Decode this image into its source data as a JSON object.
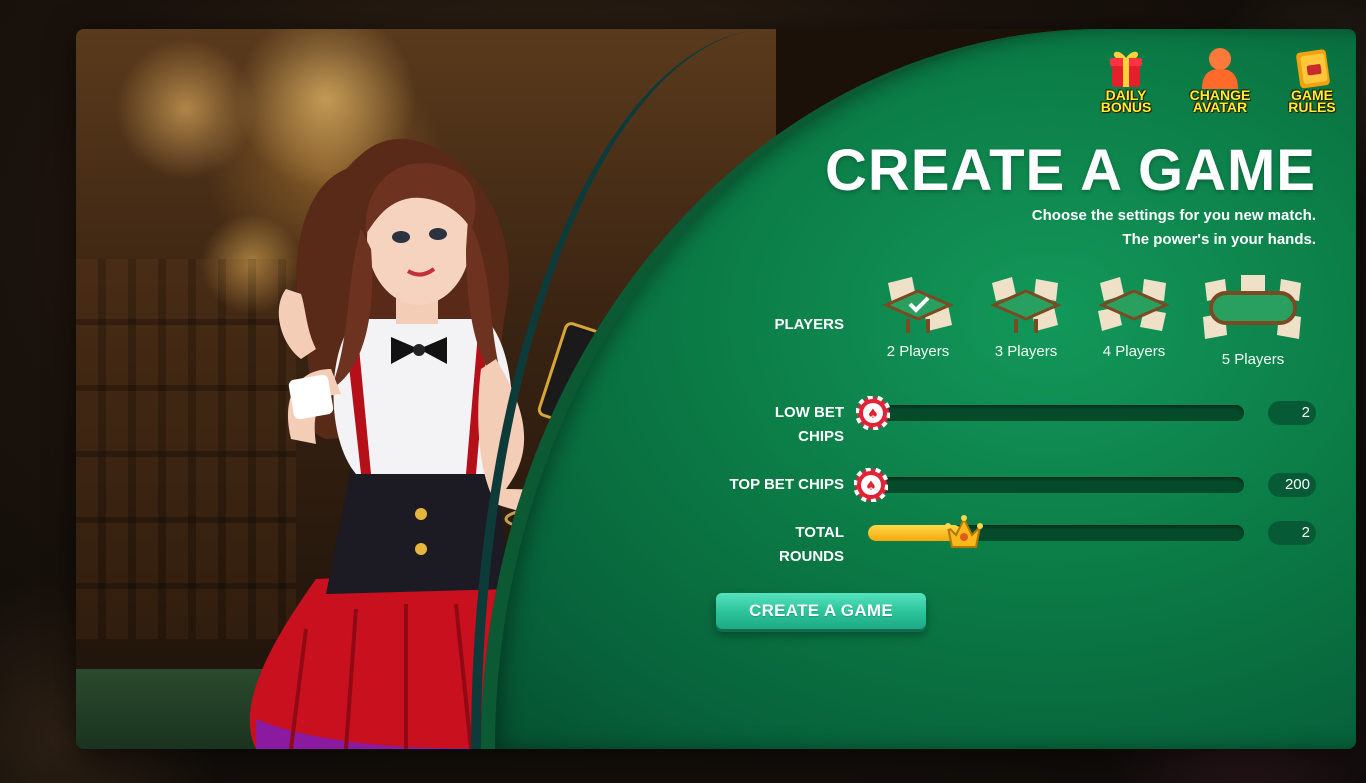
{
  "header_buttons": {
    "daily_bonus": "DAILY\nBONUS",
    "change_avatar": "CHANGE\nAVATAR",
    "game_rules": "GAME\nRULES"
  },
  "header_button_labels": {
    "daily_bonus_line1": "DAILY",
    "daily_bonus_line2": "BONUS",
    "change_avatar_line1": "CHANGE",
    "change_avatar_line2": "AVATAR",
    "game_rules_line1": "GAME",
    "game_rules_line2": "RULES"
  },
  "title": "CREATE A GAME",
  "subtitle_line1": "Choose the settings for you new match.",
  "subtitle_line2": "The power's in your hands.",
  "players": {
    "label": "PLAYERS",
    "options": [
      {
        "label": "2 Players",
        "selected": true
      },
      {
        "label": "3 Players",
        "selected": false
      },
      {
        "label": "4 Players",
        "selected": false
      },
      {
        "label": "5 Players",
        "selected": false
      }
    ]
  },
  "low_bet": {
    "label_line1": "LOW BET",
    "label_line2": "CHIPS",
    "value": "2",
    "fill": 0.0
  },
  "top_bet": {
    "label": "TOP BET CHIPS",
    "value": "200",
    "fill": 0.0
  },
  "total_rounds": {
    "label_line1": "TOTAL",
    "label_line2": "ROUNDS",
    "value": "2",
    "fill": 0.25
  },
  "create_button": "CREATE A GAME",
  "colors": {
    "felt": "#0b7a45",
    "accent_yellow": "#ffee33",
    "button_teal": "#2cc59c",
    "chip_red": "#e02436"
  },
  "icons": {
    "daily_bonus": "gift-icon",
    "change_avatar": "avatar-icon",
    "game_rules": "book-icon",
    "slider_low": "poker-chip-icon",
    "slider_top": "poker-chip-icon",
    "slider_rounds": "crown-icon",
    "selected": "checkmark-icon"
  }
}
